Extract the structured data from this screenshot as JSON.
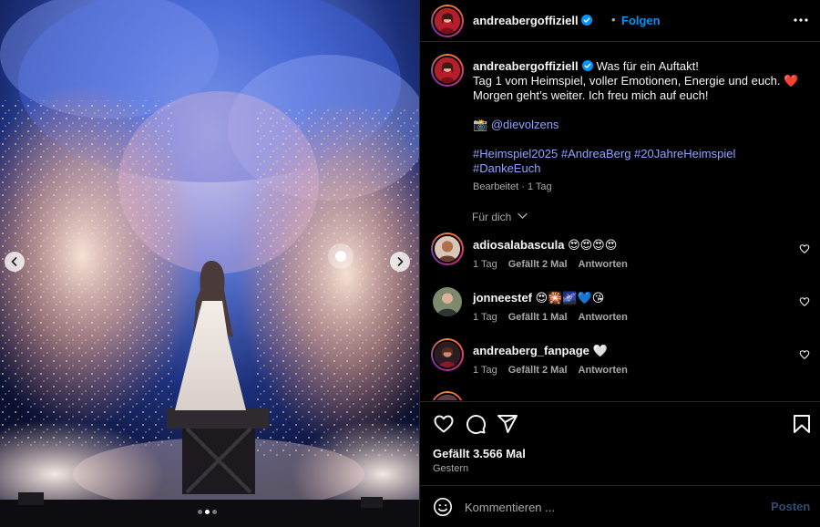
{
  "post": {
    "username": "andreabergoffiziell",
    "verified": true,
    "separator": "•",
    "follow_label": "Folgen",
    "more_icon": "more-horizontal-icon"
  },
  "caption": {
    "username": "andreabergoffiziell",
    "line1": "Was für ein Auftakt!",
    "line2": "Tag 1 vom Heimspiel, voller Emotionen, Energie und euch.",
    "line2_emoji": "❤️",
    "line3": "Morgen geht’s weiter. Ich freu mich auf euch!",
    "camera_emoji": "📸",
    "credit": "@dievolzens",
    "hashtags_line1": "#Heimspiel2025 #AndreaBerg #20JahreHeimspiel",
    "hashtags_line2": "#DankeEuch",
    "edited": "Bearbeitet",
    "time": "1 Tag"
  },
  "for_you_label": "Für dich",
  "comments": [
    {
      "username": "adiosalabascula",
      "text": "😍😍😍😍",
      "time": "1 Tag",
      "likes": "Gefällt 2 Mal",
      "reply": "Antworten"
    },
    {
      "username": "jonneestef",
      "text": "😍🎇🌌💙😘",
      "time": "1 Tag",
      "likes": "Gefällt 1 Mal",
      "reply": "Antworten"
    },
    {
      "username": "andreaberg_fanpage",
      "text": "🤍",
      "time": "1 Tag",
      "likes": "Gefällt 2 Mal",
      "reply": "Antworten"
    }
  ],
  "actions": {
    "like_icon": "heart-icon",
    "comment_icon": "comment-icon",
    "share_icon": "send-icon",
    "save_icon": "bookmark-icon",
    "likes_text": "Gefällt 3.566 Mal",
    "date": "Gestern"
  },
  "composer": {
    "emoji_icon": "emoji-icon",
    "placeholder": "Kommentieren ...",
    "post_label": "Posten"
  },
  "carousel": {
    "total": 3,
    "active": 2
  },
  "colors": {
    "link": "#0095f6",
    "hashtag": "#8fa4ff",
    "muted": "#a8a8a8",
    "background": "#000000"
  }
}
